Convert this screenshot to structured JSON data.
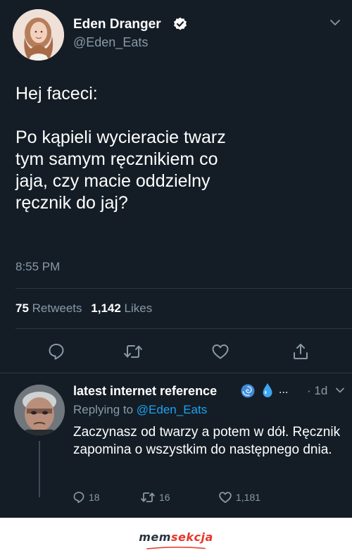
{
  "tweet": {
    "author_name": "Eden Dranger",
    "author_handle": "@Eden_Eats",
    "text_lines": [
      "Hej faceci:",
      "Po kąpieli wycieracie twarz",
      "tym samym ręcznikiem co",
      "jaja, czy macie oddzielny",
      "ręcznik do jaj?"
    ],
    "time": "8:55 PM",
    "retweets_count": "75",
    "retweets_label": "Retweets",
    "likes_count": "1,142",
    "likes_label": "Likes"
  },
  "reply": {
    "author_name": "latest internet reference",
    "ellipsis": "...",
    "time": "· 1d",
    "replying_prefix": "Replying to",
    "replying_handle": "@Eden_Eats",
    "text": "Zaczynasz od twarzy a potem w dół. Ręcznik zapomina o wszystkim do następnego dnia.",
    "reply_count": "18",
    "retweet_count": "16",
    "like_count": "1,181"
  },
  "footer": {
    "logo_part1": "mem",
    "logo_part2": "sekcja"
  },
  "colors": {
    "background": "#141d26",
    "secondary_text": "#8899a6",
    "link": "#1da1f2",
    "divider": "#2a3744",
    "brand_red": "#e8352a"
  },
  "icons": [
    "verified-badge-icon",
    "chevron-down-icon",
    "reply-icon",
    "retweet-icon",
    "like-icon",
    "share-icon",
    "cyclone-emoji-icon",
    "droplet-emoji-icon"
  ]
}
